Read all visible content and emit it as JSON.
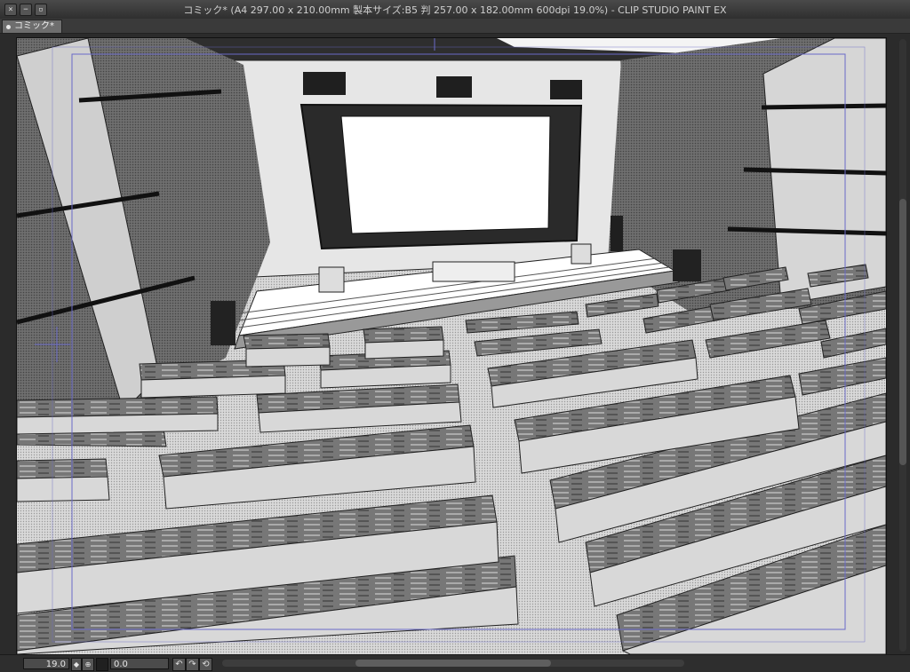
{
  "window": {
    "title": "コミック* (A4 297.00 x 210.00mm 製本サイズ:B5 判 257.00 x 182.00mm 600dpi 19.0%)  - CLIP STUDIO PAINT EX",
    "buttons": [
      "close",
      "minimize",
      "maximize"
    ]
  },
  "tabs": [
    {
      "label": "コミック*",
      "active": true
    }
  ],
  "canvas": {
    "description_icon": "illustration",
    "colors": {
      "paper": "#e8e8e8",
      "dark": "#3a3a3a",
      "mid": "#8a8a8a",
      "light": "#d2d2d2",
      "guide": "#6a6ac8"
    }
  },
  "statusbar": {
    "zoom": "19.0",
    "angle": "0.0",
    "rotate_left_icon": "rotate-left-icon",
    "rotate_right_icon": "rotate-right-icon",
    "reset_icon": "reset-rotation-icon"
  }
}
